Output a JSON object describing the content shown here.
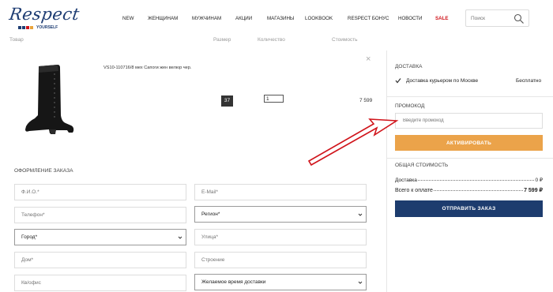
{
  "header": {
    "logo_text": "Respect",
    "logo_sub": "YOURSELF",
    "nav": [
      {
        "label": "NEW"
      },
      {
        "label": "ЖЕНЩИНАМ"
      },
      {
        "label": "МУЖЧИНАМ"
      },
      {
        "label": "АКЦИИ"
      },
      {
        "label": "МАГАЗИНЫ"
      },
      {
        "label": "LOOKBOOK"
      },
      {
        "label": "RESPECT БОНУС"
      },
      {
        "label": "НОВОСТИ"
      },
      {
        "label": "SALE"
      }
    ],
    "search_placeholder": "Поиск"
  },
  "cart": {
    "columns": {
      "product": "Товар",
      "size": "Размер",
      "quantity": "Количество",
      "price": "Стоимость"
    },
    "item": {
      "title": "VS10-110716/8 мех Сапоги жен велюр чер.",
      "size": "37",
      "quantity": "1",
      "price": "7 599",
      "remove": "×"
    }
  },
  "order_form": {
    "title": "ОФОРМЛЕНИЕ ЗАКАЗА",
    "fields": {
      "name": "Ф.И.О.*",
      "email": "E-Mail*",
      "phone": "Телефон*",
      "region": "Регион*",
      "city": "Город*",
      "street": "Улица*",
      "house": "Дом*",
      "building": "Строение",
      "apartment": "Кв/офис",
      "delivery_time": "Желаемое время доставки"
    }
  },
  "sidebar": {
    "delivery_title": "ДОСТАВКА",
    "delivery_option": "Доставка курьером по Москве",
    "delivery_option_price": "Бесплатно",
    "promo_title": "ПРОМОКОД",
    "promo_placeholder": "Введите промокод",
    "activate_label": "АКТИВИРОВАТЬ",
    "total_title": "ОБЩАЯ СТОИМОСТЬ",
    "delivery_cost_label": "Доставка",
    "delivery_cost_value": "0 ₽",
    "total_label": "Всего к оплате",
    "total_value": "7 599 ₽",
    "submit_label": "ОТПРАВИТЬ ЗАКАЗ"
  },
  "colors": {
    "brand": "#1e3d73",
    "accent_orange": "#eba34a",
    "submit_blue": "#1d3c6e",
    "sale_red": "#d0141b",
    "annotation_arrow": "#d0141b"
  }
}
